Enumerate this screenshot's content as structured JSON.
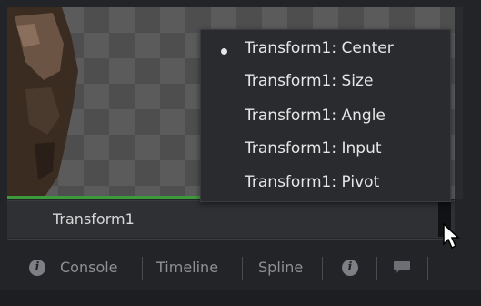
{
  "viewer": {
    "label": "Transform1"
  },
  "context_menu": {
    "items": [
      {
        "label": "Transform1: Center",
        "selected": true
      },
      {
        "label": "Transform1: Size",
        "selected": false
      },
      {
        "label": "Transform1: Angle",
        "selected": false
      },
      {
        "label": "Transform1: Input",
        "selected": false
      },
      {
        "label": "Transform1: Pivot",
        "selected": false
      }
    ]
  },
  "tabs": {
    "console": "Console",
    "timeline": "Timeline",
    "spline": "Spline"
  },
  "icons": {
    "info": "info-icon",
    "chat": "chat-bubble-icon",
    "cursor": "mouse-pointer-icon"
  },
  "colors": {
    "accent_green": "#3d9a3a",
    "menu_bg": "#2a2b2f",
    "text": "#e6e6e6"
  }
}
